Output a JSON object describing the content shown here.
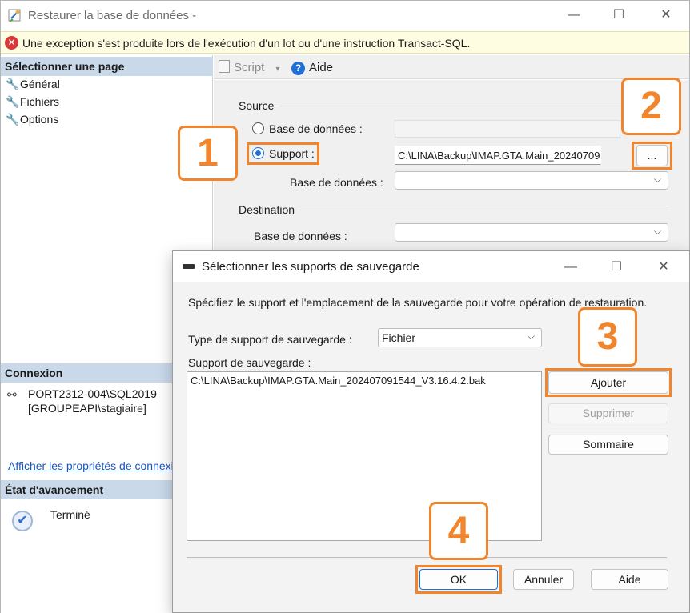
{
  "main_window": {
    "title": "Restaurer la base de données -",
    "controls": {
      "minimize": "—",
      "maximize": "☐",
      "close": "✕"
    }
  },
  "error_bar": {
    "icon": "error-icon",
    "message": "Une exception s'est produite lors de l'exécution d'un lot ou d'une instruction Transact-SQL."
  },
  "left_panel": {
    "select_page_header": "Sélectionner une page",
    "pages": [
      "Général",
      "Fichiers",
      "Options"
    ],
    "connection_header": "Connexion",
    "server": "PORT2312-004\\SQL2019",
    "user": "[GROUPEAPI\\stagiaire]",
    "connection_link": "Afficher les propriétés de connexion",
    "progress_header": "État d'avancement",
    "progress_status": "Terminé"
  },
  "toolbar": {
    "script_label": "Script",
    "help_label": "Aide"
  },
  "source": {
    "label": "Source",
    "database_radio": "Base de données :",
    "device_radio": "Support :",
    "device_path": "C:\\LINA\\Backup\\IMAP.GTA.Main_20240709",
    "browse_label": "...",
    "database_label": "Base de données :"
  },
  "destination": {
    "label": "Destination",
    "database_label": "Base de données :"
  },
  "dialog": {
    "title": "Sélectionner les supports de sauvegarde",
    "description": "Spécifiez le support et l'emplacement de la sauvegarde pour votre opération de restauration.",
    "media_type_label": "Type de support de sauvegarde :",
    "media_type_value": "Fichier",
    "media_label": "Support de sauvegarde :",
    "media_items": [
      "C:\\LINA\\Backup\\IMAP.GTA.Main_202407091544_V3.16.4.2.bak"
    ],
    "add_button": "Ajouter",
    "remove_button": "Supprimer",
    "contents_button": "Sommaire",
    "ok_button": "OK",
    "cancel_button": "Annuler",
    "help_button": "Aide"
  },
  "annotations": [
    "1",
    "2",
    "3",
    "4"
  ],
  "colors": {
    "annotation": "#f0852d",
    "accent": "#1e6fd9",
    "error": "#d9383a",
    "header_bg": "#c9d9ea"
  }
}
